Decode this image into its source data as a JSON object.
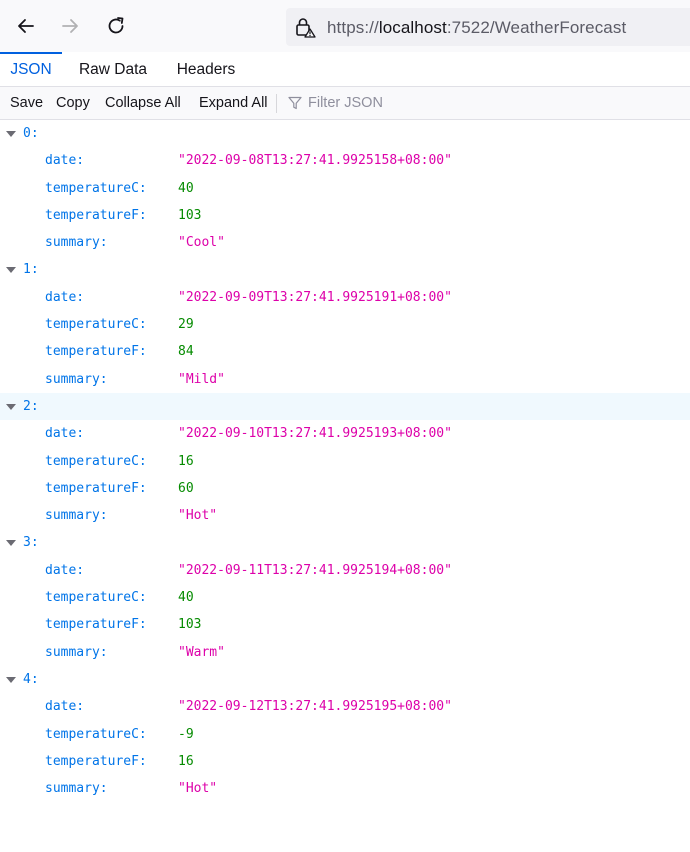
{
  "browser": {
    "url_prefix": "https://",
    "url_host": "localhost",
    "url_rest": ":7522/WeatherForecast"
  },
  "tabs": [
    {
      "label": "JSON",
      "active": true
    },
    {
      "label": "Raw Data",
      "active": false
    },
    {
      "label": "Headers",
      "active": false
    }
  ],
  "toolbar": {
    "save_label": "Save",
    "copy_label": "Copy",
    "collapse_label": "Collapse All",
    "expand_label": "Expand All",
    "filter_placeholder": "Filter JSON"
  },
  "items": [
    {
      "index": "0:",
      "fields": [
        {
          "key": "date:",
          "value": "\"2022-09-08T13:27:41.9925158+08:00\"",
          "type": "str"
        },
        {
          "key": "temperatureC:",
          "value": "40",
          "type": "num"
        },
        {
          "key": "temperatureF:",
          "value": "103",
          "type": "num"
        },
        {
          "key": "summary:",
          "value": "\"Cool\"",
          "type": "str"
        }
      ]
    },
    {
      "index": "1:",
      "fields": [
        {
          "key": "date:",
          "value": "\"2022-09-09T13:27:41.9925191+08:00\"",
          "type": "str"
        },
        {
          "key": "temperatureC:",
          "value": "29",
          "type": "num"
        },
        {
          "key": "temperatureF:",
          "value": "84",
          "type": "num"
        },
        {
          "key": "summary:",
          "value": "\"Mild\"",
          "type": "str"
        }
      ]
    },
    {
      "index": "2:",
      "fields": [
        {
          "key": "date:",
          "value": "\"2022-09-10T13:27:41.9925193+08:00\"",
          "type": "str"
        },
        {
          "key": "temperatureC:",
          "value": "16",
          "type": "num"
        },
        {
          "key": "temperatureF:",
          "value": "60",
          "type": "num"
        },
        {
          "key": "summary:",
          "value": "\"Hot\"",
          "type": "str"
        }
      ]
    },
    {
      "index": "3:",
      "fields": [
        {
          "key": "date:",
          "value": "\"2022-09-11T13:27:41.9925194+08:00\"",
          "type": "str"
        },
        {
          "key": "temperatureC:",
          "value": "40",
          "type": "num"
        },
        {
          "key": "temperatureF:",
          "value": "103",
          "type": "num"
        },
        {
          "key": "summary:",
          "value": "\"Warm\"",
          "type": "str"
        }
      ]
    },
    {
      "index": "4:",
      "fields": [
        {
          "key": "date:",
          "value": "\"2022-09-12T13:27:41.9925195+08:00\"",
          "type": "str"
        },
        {
          "key": "temperatureC:",
          "value": "-9",
          "type": "num"
        },
        {
          "key": "temperatureF:",
          "value": "16",
          "type": "num"
        },
        {
          "key": "summary:",
          "value": "\"Hot\"",
          "type": "str"
        }
      ]
    }
  ],
  "colors": {
    "key": "#0074e8",
    "string": "#dd00a9",
    "number": "#058b00",
    "accent": "#0060df",
    "hover_row": "#f0f9fe"
  }
}
